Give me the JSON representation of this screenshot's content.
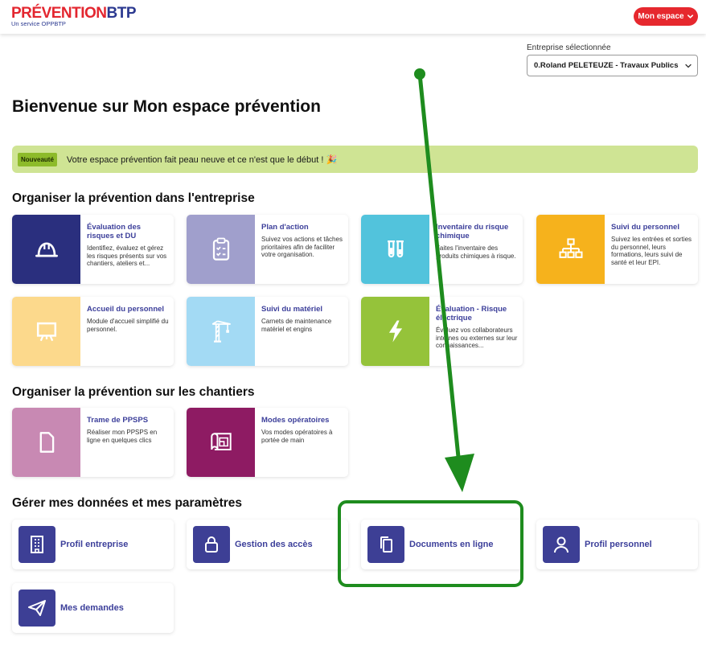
{
  "header": {
    "logo_part1": "PRÉVENTION",
    "logo_part2": "BTP",
    "logo_sub": "Un service OPPBTP",
    "espace_button": "Mon espace"
  },
  "company": {
    "label": "Entreprise sélectionnée",
    "selected": "0.Roland PELETEUZE - Travaux Publics"
  },
  "welcome_title": "Bienvenue sur Mon espace prévention",
  "banner": {
    "badge": "Nouveauté",
    "text": "Votre espace prévention fait peau neuve et ce n'est que le début ! 🎉"
  },
  "section_entreprise": {
    "title": "Organiser la prévention dans l'entreprise",
    "cards": [
      {
        "title": "Évaluation des risques et DU",
        "desc": "Identifiez, évaluez et gérez les risques présents sur vos chantiers, ateliers et...",
        "color": "#2a2f7e",
        "icon": "helmet-icon"
      },
      {
        "title": "Plan d'action",
        "desc": "Suivez vos actions et tâches prioritaires afin de faciliter votre organisation.",
        "color": "#a09fcc",
        "icon": "clipboard-icon"
      },
      {
        "title": "Inventaire du risque chimique",
        "desc": "Faites l'inventaire des produits chimiques à risque.",
        "color": "#52c3dc",
        "icon": "test-tubes-icon"
      },
      {
        "title": "Suivi du personnel",
        "desc": "Suivez les entrées et sorties du personnel, leurs formations, leurs suivi de santé et leur EPI.",
        "color": "#f6b21c",
        "icon": "org-chart-icon"
      },
      {
        "title": "Accueil du personnel",
        "desc": "Module d'accueil simplifié du personnel.",
        "color": "#fcd98c",
        "icon": "presentation-board-icon"
      },
      {
        "title": "Suivi du matériel",
        "desc": "Carnets de maintenance matériel et engins",
        "color": "#a3daf4",
        "icon": "crane-icon"
      },
      {
        "title": "Évaluation - Risque électrique",
        "desc": "Évaluez vos collaborateurs internes ou externes sur leur connaissances...",
        "color": "#95c33a",
        "icon": "lightning-icon"
      }
    ]
  },
  "section_chantiers": {
    "title": "Organiser la prévention sur les chantiers",
    "cards": [
      {
        "title": "Trame de PPSPS",
        "desc": "Réaliser mon PPSPS en ligne en quelques clics",
        "color": "#c889b3",
        "icon": "document-icon"
      },
      {
        "title": "Modes opératoires",
        "desc": "Vos modes opératoires à portée de main",
        "color": "#8e1b63",
        "icon": "blueprint-icon"
      }
    ]
  },
  "section_params": {
    "title": "Gérer mes données et mes paramètres",
    "items": [
      {
        "label": "Profil entreprise",
        "icon": "building-icon"
      },
      {
        "label": "Gestion des accès",
        "icon": "lock-icon"
      },
      {
        "label": "Documents en ligne",
        "icon": "documents-icon"
      },
      {
        "label": "Profil personnel",
        "icon": "user-icon"
      },
      {
        "label": "Mes demandes",
        "icon": "send-icon"
      }
    ]
  },
  "colors": {
    "brand_red": "#e3262f",
    "brand_blue": "#2b3990",
    "annotation_green": "#1e8c1e"
  }
}
